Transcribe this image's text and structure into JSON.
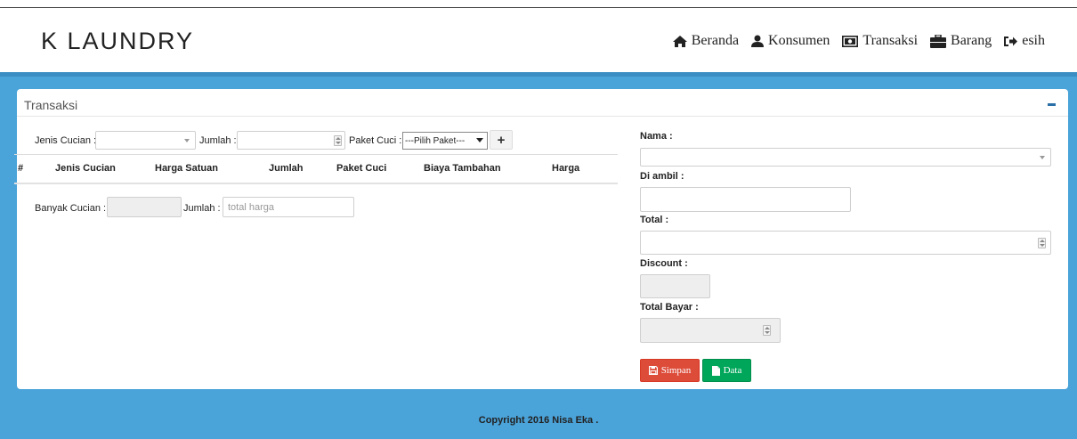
{
  "brand": "K LAUNDRY",
  "menu": {
    "beranda": "Beranda",
    "konsumen": "Konsumen",
    "transaksi": "Transaksi",
    "barang": "Barang",
    "user": "esih"
  },
  "panel": {
    "title": "Transaksi"
  },
  "form_left": {
    "jenis_cucian_label": "Jenis Cucian :",
    "jumlah_label": "Jumlah :",
    "paket_cuci_label": "Paket Cuci :",
    "paket_cuci_value": "---Pilih Paket---",
    "columns": [
      "#",
      "Jenis Cucian",
      "Harga Satuan",
      "Jumlah",
      "Paket Cuci",
      "Biaya Tambahan",
      "Harga"
    ],
    "banyak_cucian_label": "Banyak Cucian :",
    "jumlah2_label": "Jumlah :",
    "total_harga_placeholder": "total harga"
  },
  "form_right": {
    "nama_label": "Nama :",
    "diambil_label": "Di ambil :",
    "total_label": "Total :",
    "discount_label": "Discount :",
    "total_bayar_label": "Total Bayar :",
    "simpan_label": "Simpan",
    "data_label": "Data"
  },
  "footer": "Copyright 2016 Nisa Eka .",
  "colors": {
    "page_bg": "#4aa3d9",
    "simpan_btn": "#dd4b39",
    "data_btn": "#00a65a",
    "collapse_icon": "#2a6fa8"
  }
}
